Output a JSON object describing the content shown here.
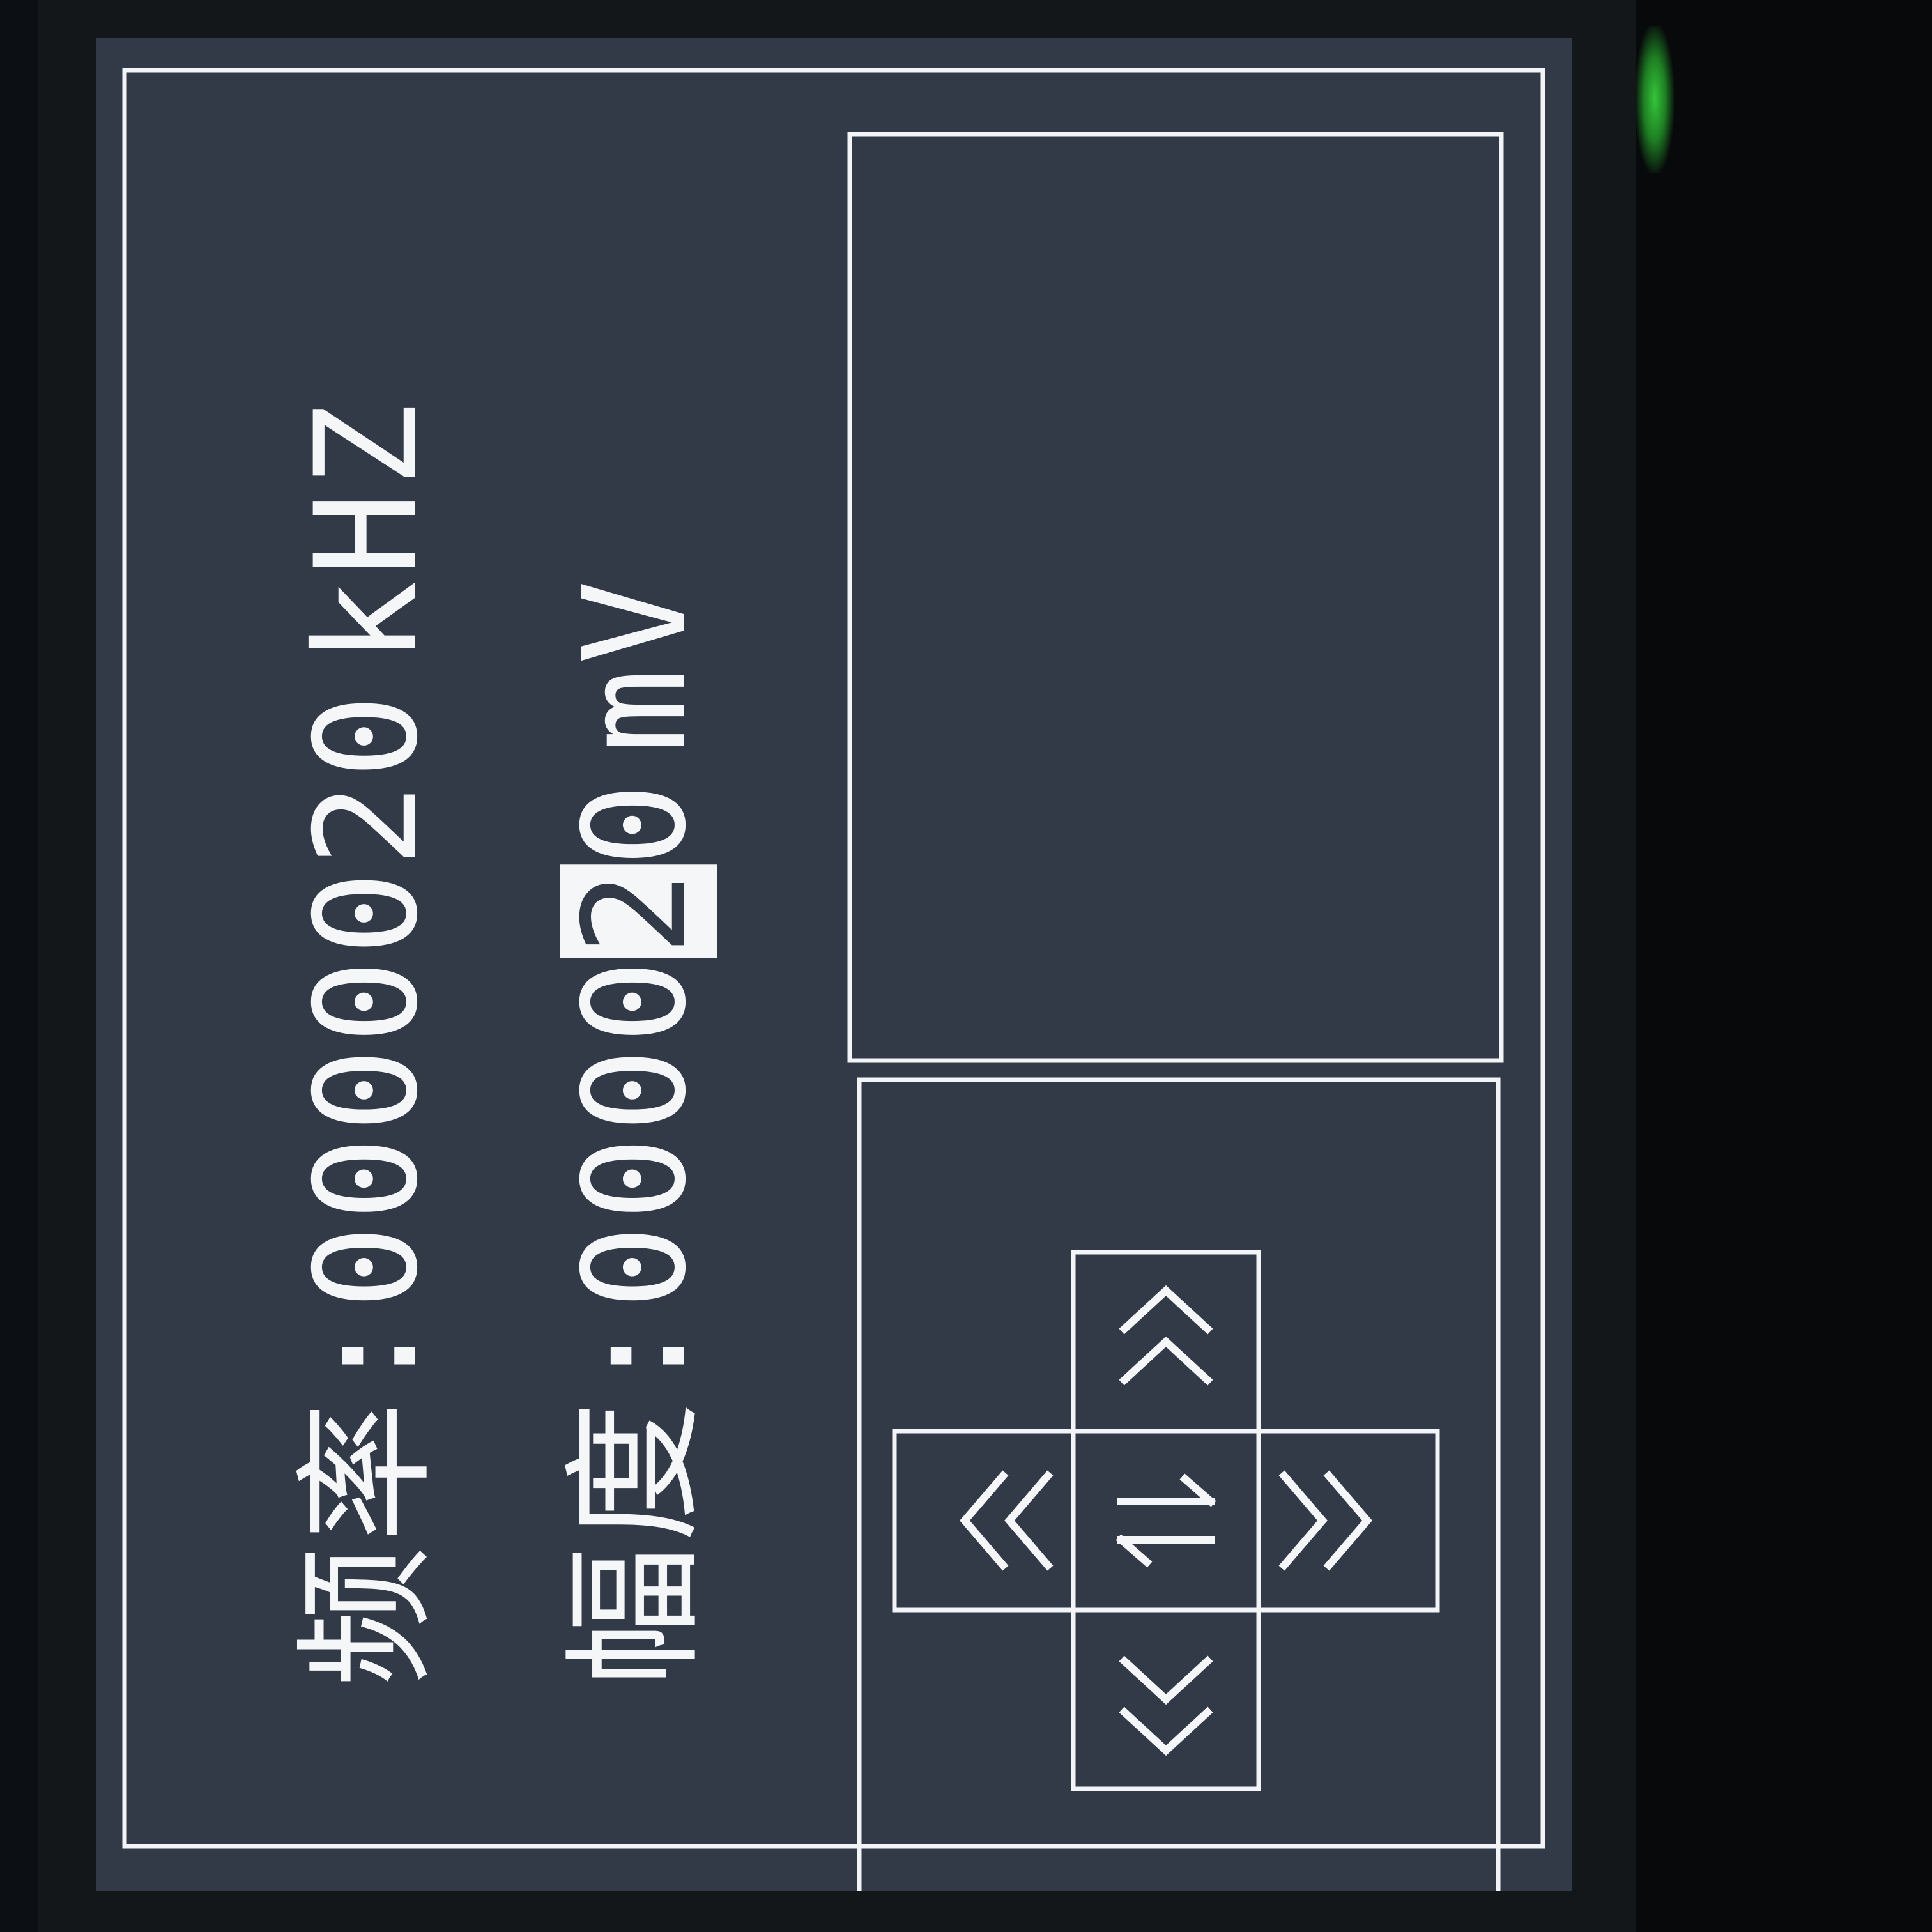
{
  "device": {
    "frequency": {
      "label": "频率",
      "separator": ":",
      "digits_before_cursor": "0000020",
      "unit": "kHZ"
    },
    "amplitude": {
      "label": "幅度",
      "separator": ":",
      "digits_before_cursor": "0000",
      "cursor_digit": "2",
      "digits_after_cursor": "0",
      "unit": "mV"
    }
  },
  "keypad": {
    "up": "︿︿",
    "down": "﹀﹀",
    "left": "《",
    "right": "》",
    "center": "⇌"
  },
  "colors": {
    "screen_bg": "#323a48",
    "foreground": "#f4f6f8",
    "status_led": "#36c43a"
  }
}
